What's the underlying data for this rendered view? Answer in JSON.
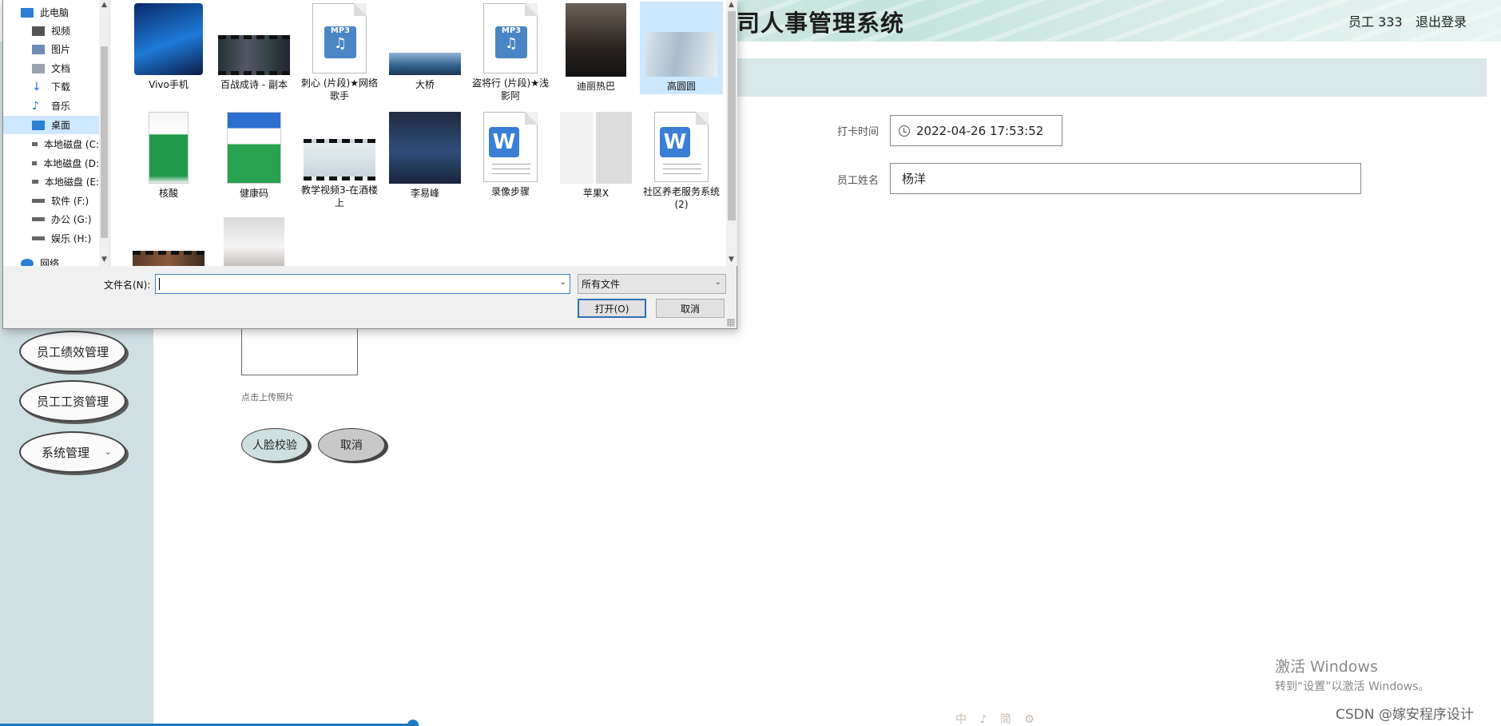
{
  "app": {
    "title": "司人事管理系统",
    "user_label": "员工 333",
    "logout_label": "退出登录"
  },
  "sidebar": {
    "items": [
      {
        "label": "员工绩效管理"
      },
      {
        "label": "员工工资管理"
      },
      {
        "label": "系统管理"
      }
    ]
  },
  "form": {
    "time_label": "打卡时间",
    "time_value": "2022-04-26 17:53:52",
    "name_label": "员工姓名",
    "name_value": "杨洋",
    "upload_hint": "点击上传照片",
    "face_button": "人脸校验",
    "cancel_button": "取消"
  },
  "dialog": {
    "nav": [
      {
        "label": "此电脑",
        "icon": "pc-icon"
      },
      {
        "label": "视频",
        "icon": "video-icon"
      },
      {
        "label": "图片",
        "icon": "picture-icon"
      },
      {
        "label": "文档",
        "icon": "document-icon"
      },
      {
        "label": "下载",
        "icon": "download-icon"
      },
      {
        "label": "音乐",
        "icon": "music-icon"
      },
      {
        "label": "桌面",
        "icon": "desktop-icon"
      },
      {
        "label": "本地磁盘 (C:",
        "icon": "drive-icon"
      },
      {
        "label": "本地磁盘 (D:",
        "icon": "drive-icon"
      },
      {
        "label": "本地磁盘 (E:",
        "icon": "drive-icon"
      },
      {
        "label": "软件 (F:)",
        "icon": "drive-icon"
      },
      {
        "label": "办公 (G:)",
        "icon": "drive-icon"
      },
      {
        "label": "娱乐 (H:)",
        "icon": "drive-icon"
      },
      {
        "label": "网络",
        "icon": "network-icon"
      }
    ],
    "files": [
      {
        "name": "Vivo手机",
        "kind": "phone-photo"
      },
      {
        "name": "百战成诗 - 副本",
        "kind": "video"
      },
      {
        "name": "刺心 (片段)★网络歌手",
        "kind": "mp3"
      },
      {
        "name": "大桥",
        "kind": "landscape-photo"
      },
      {
        "name": "盗将行 (片段)★浅影阿",
        "kind": "mp3"
      },
      {
        "name": "迪丽热巴",
        "kind": "portrait-photo"
      },
      {
        "name": "高圆圆",
        "kind": "portrait-photo"
      },
      {
        "name": "核酸",
        "kind": "phone-screenshot"
      },
      {
        "name": "健康码",
        "kind": "qr-screenshot"
      },
      {
        "name": "教学视频3-在酒楼上",
        "kind": "video"
      },
      {
        "name": "李易峰",
        "kind": "portrait-photo"
      },
      {
        "name": "录像步骤",
        "kind": "word-doc"
      },
      {
        "name": "苹果X",
        "kind": "phone-photo"
      },
      {
        "name": "社区养老服务系统 (2)",
        "kind": "word-doc"
      },
      {
        "name": "",
        "kind": "video"
      },
      {
        "name": "",
        "kind": "portrait-photo"
      }
    ],
    "filename_label": "文件名(N):",
    "filename_value": "",
    "filetype_value": "所有文件",
    "open_button": "打开(O)",
    "cancel_button": "取消",
    "mp3_badge": "MP3",
    "word_badge": "W"
  },
  "overlay": {
    "activate_title": "激活 Windows",
    "activate_sub": "转到“设置”以激活 Windows。",
    "watermark": "CSDN @嫁安程序设计",
    "tray_glyphs": "中 ♪ 简 ⚙"
  },
  "colors": {
    "accent": "#1a78c2",
    "sidebar_bg": "#cfe0e2",
    "selection": "#cce8ff"
  }
}
